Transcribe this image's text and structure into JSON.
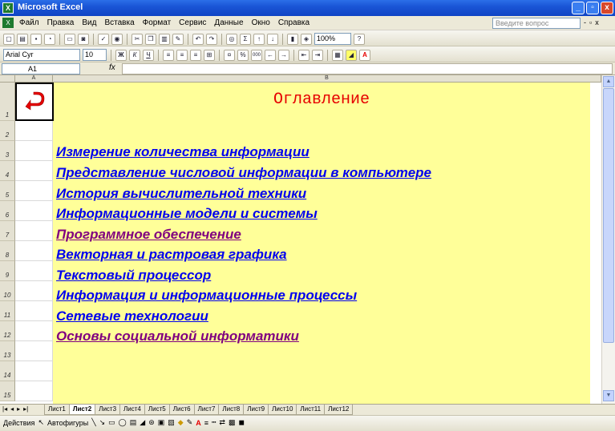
{
  "window": {
    "title": "Microsoft Excel",
    "buttons": [
      "_",
      "▫",
      "x"
    ]
  },
  "menu": {
    "items": [
      "Файл",
      "Правка",
      "Вид",
      "Вставка",
      "Формат",
      "Сервис",
      "Данные",
      "Окно",
      "Справка"
    ],
    "help_placeholder": "Введите вопрос",
    "mini_buttons": [
      "-",
      "▫",
      "x"
    ]
  },
  "toolbar_standard": {
    "zoom": "100%"
  },
  "toolbar_format": {
    "font": "Arial Cyr",
    "size": "10",
    "bold": "Ж",
    "italic": "К",
    "underline": "Ч",
    "percent": "%",
    "thousands": "000"
  },
  "formula_bar": {
    "cell_ref": "A1",
    "fx": "fx",
    "value": ""
  },
  "grid": {
    "col_a": "A",
    "col_b": "B",
    "rows": [
      "1",
      "2",
      "3",
      "4",
      "5",
      "6",
      "7",
      "8",
      "9",
      "10",
      "11",
      "12",
      "13",
      "14",
      "15"
    ]
  },
  "content": {
    "title": "Оглавление",
    "links": [
      {
        "text": "Измерение количества информации",
        "visited": false
      },
      {
        "text": "Представление числовой информации в компьютере",
        "visited": false
      },
      {
        "text": "История вычислительной техники",
        "visited": false
      },
      {
        "text": "Информационные модели и системы",
        "visited": false
      },
      {
        "text": "Программное обеспечение",
        "visited": true
      },
      {
        "text": "Векторная и растровая графика",
        "visited": false
      },
      {
        "text": "Текстовый процессор",
        "visited": false
      },
      {
        "text": "Информация и информационные процессы",
        "visited": false
      },
      {
        "text": "Сетевые технологии",
        "visited": false
      },
      {
        "text": "Основы социальной информатики",
        "visited": true
      }
    ],
    "colors": {
      "title": "#e60000",
      "link": "#0000ee",
      "visited": "#800080",
      "background": "#ffff99"
    }
  },
  "sheets": {
    "tabs": [
      "Лист1",
      "Лист2",
      "Лист3",
      "Лист4",
      "Лист5",
      "Лист6",
      "Лист7",
      "Лист8",
      "Лист9",
      "Лист10",
      "Лист11",
      "Лист12"
    ],
    "active": 1
  },
  "drawing": {
    "actions": "Действия",
    "autoshapes": "Автофигуры"
  }
}
